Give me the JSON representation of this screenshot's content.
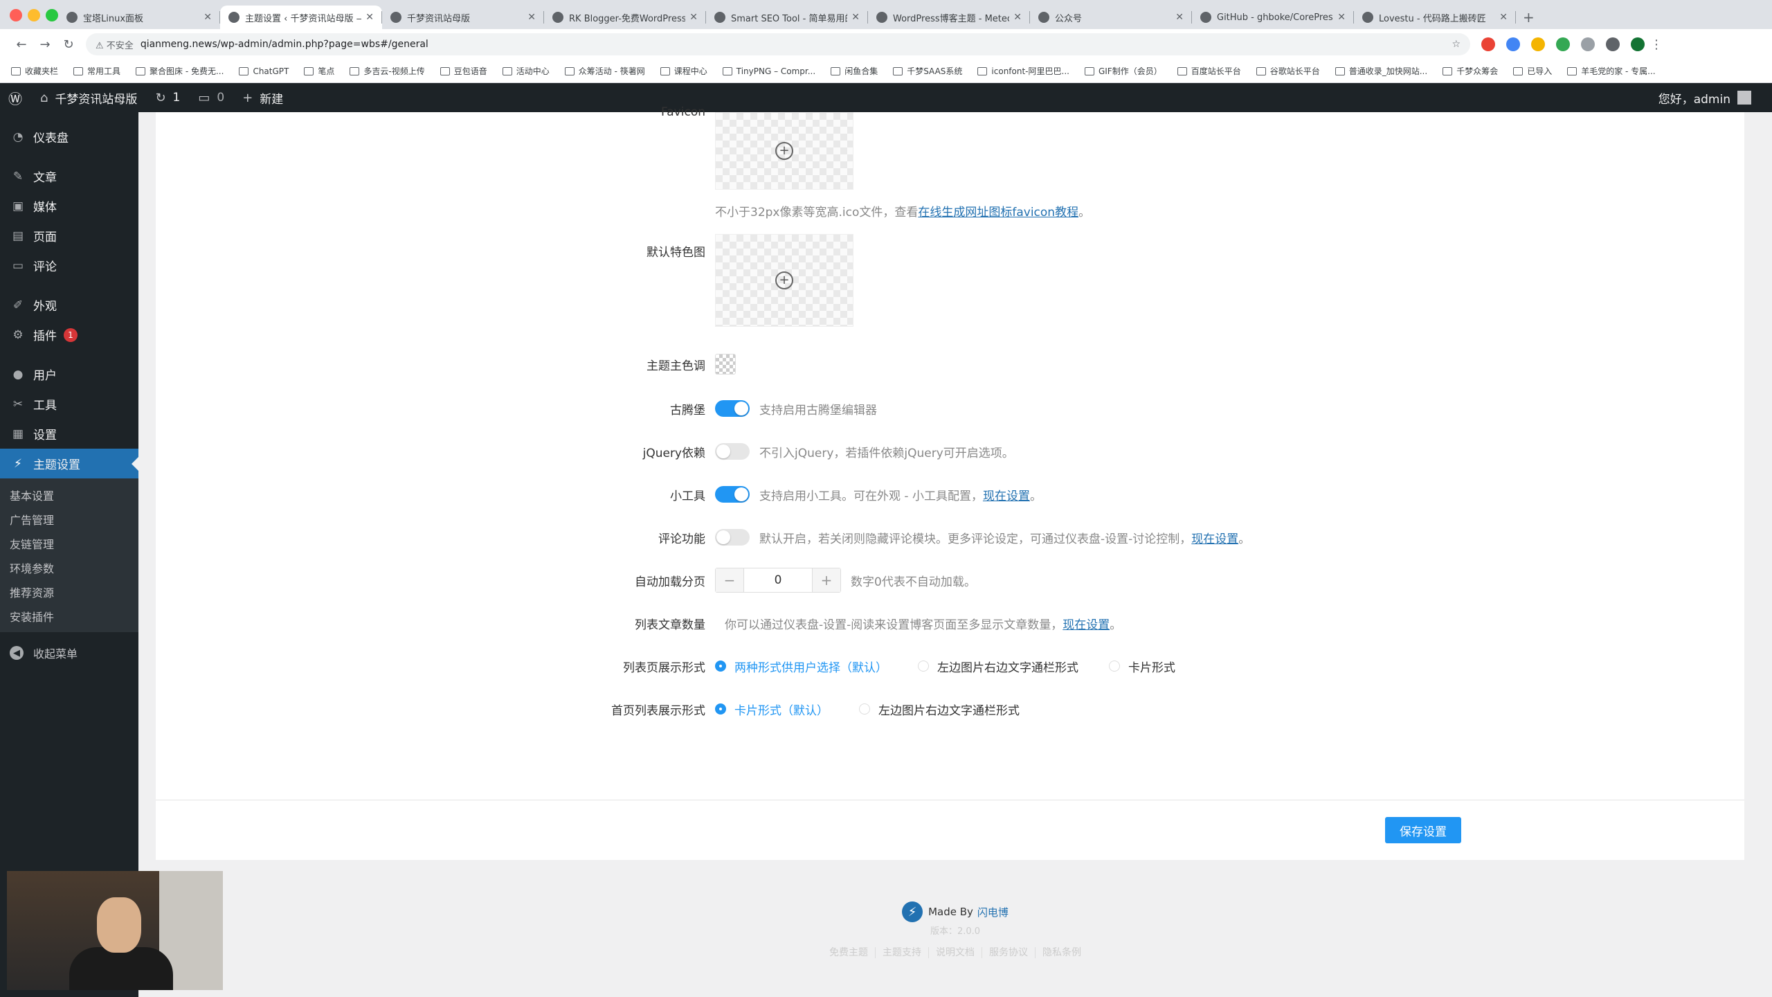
{
  "browser": {
    "tabs": [
      {
        "title": "宝塔Linux面板",
        "active": false
      },
      {
        "title": "主题设置 ‹ 千梦资讯站母版 — WordPress",
        "active": true
      },
      {
        "title": "千梦资讯站母版",
        "active": false
      },
      {
        "title": "RK Blogger-免费WordPress主题",
        "active": false
      },
      {
        "title": "Smart SEO Tool - 简单易用的SEO插件",
        "active": false
      },
      {
        "title": "WordPress博客主题 - Meteor",
        "active": false
      },
      {
        "title": "公众号",
        "active": false
      },
      {
        "title": "GitHub - ghboke/CorePress",
        "active": false
      },
      {
        "title": "Lovestu - 代码路上搬砖匠",
        "active": false
      }
    ],
    "security_label": "不安全",
    "url": "qianmeng.news/wp-admin/admin.php?page=wbs#/general",
    "bookmarks": [
      "收藏夹栏",
      "常用工具",
      "聚合图床 - 免费无...",
      "ChatGPT",
      "笔点",
      "多吉云-视频上传",
      "豆包语音",
      "活动中心",
      "众筹活动 - 筷著网",
      "课程中心",
      "TinyPNG – Compr...",
      "闲鱼合集",
      "千梦SAAS系统",
      "iconfont-阿里巴巴...",
      "GIF制作（会员）",
      "百度站长平台",
      "谷歌站长平台",
      "普通收录_加快网站...",
      "千梦众筹会",
      "已导入",
      "羊毛党的家 - 专属..."
    ]
  },
  "adminbar": {
    "site_name": "千梦资讯站母版",
    "updates_count": "1",
    "comments_count": "0",
    "new_label": "新建",
    "greeting": "您好，admin"
  },
  "sidebar": {
    "items": [
      {
        "label": "仪表盘",
        "icon": "dashboard-icon"
      },
      {
        "label": "文章",
        "icon": "pin-icon"
      },
      {
        "label": "媒体",
        "icon": "media-icon"
      },
      {
        "label": "页面",
        "icon": "page-icon"
      },
      {
        "label": "评论",
        "icon": "comment-icon"
      },
      {
        "label": "外观",
        "icon": "brush-icon"
      },
      {
        "label": "插件",
        "icon": "plugin-icon",
        "badge": "1"
      },
      {
        "label": "用户",
        "icon": "user-icon"
      },
      {
        "label": "工具",
        "icon": "wrench-icon"
      },
      {
        "label": "设置",
        "icon": "settings-icon"
      },
      {
        "label": "主题设置",
        "icon": "bolt-icon",
        "current": true
      }
    ],
    "submenu": [
      "基本设置",
      "广告管理",
      "友链管理",
      "环境参数",
      "推荐资源",
      "安装插件"
    ],
    "collapse_label": "收起菜单"
  },
  "settings": {
    "favicon": {
      "label": "Favicon",
      "hint_prefix": "不小于32px像素等宽高.ico文件，查看",
      "hint_link": "在线生成网址图标favicon教程",
      "hint_suffix": "。"
    },
    "default_image": {
      "label": "默认特色图"
    },
    "theme_color": {
      "label": "主题主色调"
    },
    "gutenberg": {
      "label": "古腾堡",
      "on": true,
      "desc": "支持启用古腾堡编辑器"
    },
    "jquery": {
      "label": "jQuery依赖",
      "on": false,
      "desc": "不引入jQuery，若插件依赖jQuery可开启选项。"
    },
    "widgets": {
      "label": "小工具",
      "on": true,
      "desc": "支持启用小工具。可在外观 - 小工具配置，",
      "link": "现在设置",
      "suffix": "。"
    },
    "comments": {
      "label": "评论功能",
      "on": false,
      "desc": "默认开启，若关闭则隐藏评论模块。更多评论设定，可通过仪表盘-设置-讨论控制，",
      "link": "现在设置",
      "suffix": "。"
    },
    "autoload": {
      "label": "自动加载分页",
      "value": "0",
      "minus": "−",
      "plus": "+",
      "desc": "数字0代表不自动加载。"
    },
    "list_count": {
      "label": "列表文章数量",
      "desc": "你可以通过仪表盘-设置-阅读来设置博客页面至多显示文章数量，",
      "link": "现在设置",
      "suffix": "。"
    },
    "list_style": {
      "label": "列表页展示形式",
      "options": [
        "两种形式供用户选择（默认）",
        "左边图片右边文字通栏形式",
        "卡片形式"
      ],
      "selected": 0
    },
    "home_style": {
      "label": "首页列表展示形式",
      "options": [
        "卡片形式（默认）",
        "左边图片右边文字通栏形式"
      ],
      "selected": 0
    },
    "save_label": "保存设置"
  },
  "credit": {
    "made_by": "Made By",
    "author": "闪电博",
    "version": "版本：2.0.0",
    "links": [
      "免费主题",
      "主题支持",
      "说明文档",
      "服务协议",
      "隐私条例"
    ]
  },
  "colors": {
    "accent": "#2196f3",
    "wp_blue": "#2271b1",
    "admin_dark": "#1d2327"
  }
}
